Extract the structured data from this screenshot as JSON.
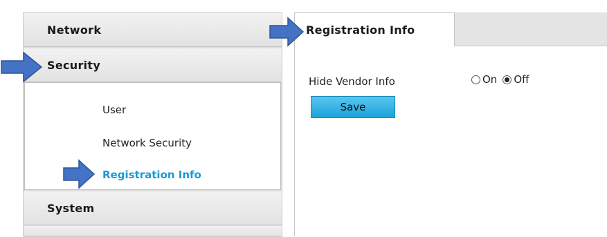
{
  "sidebar": {
    "headers": {
      "network": "Network",
      "security": "Security",
      "system": "System"
    },
    "submenu": {
      "user": "User",
      "network_security": "Network Security",
      "registration_info": "Registration Info"
    }
  },
  "tabs": {
    "active": "Registration Info"
  },
  "form": {
    "hide_vendor_label": "Hide Vendor Info",
    "options": {
      "on": "On",
      "off": "Off",
      "selected": "Off"
    },
    "save_label": "Save"
  },
  "colors": {
    "accent": "#1a9ad6",
    "arrow": "#4472c4",
    "button": "#1aa3db"
  }
}
